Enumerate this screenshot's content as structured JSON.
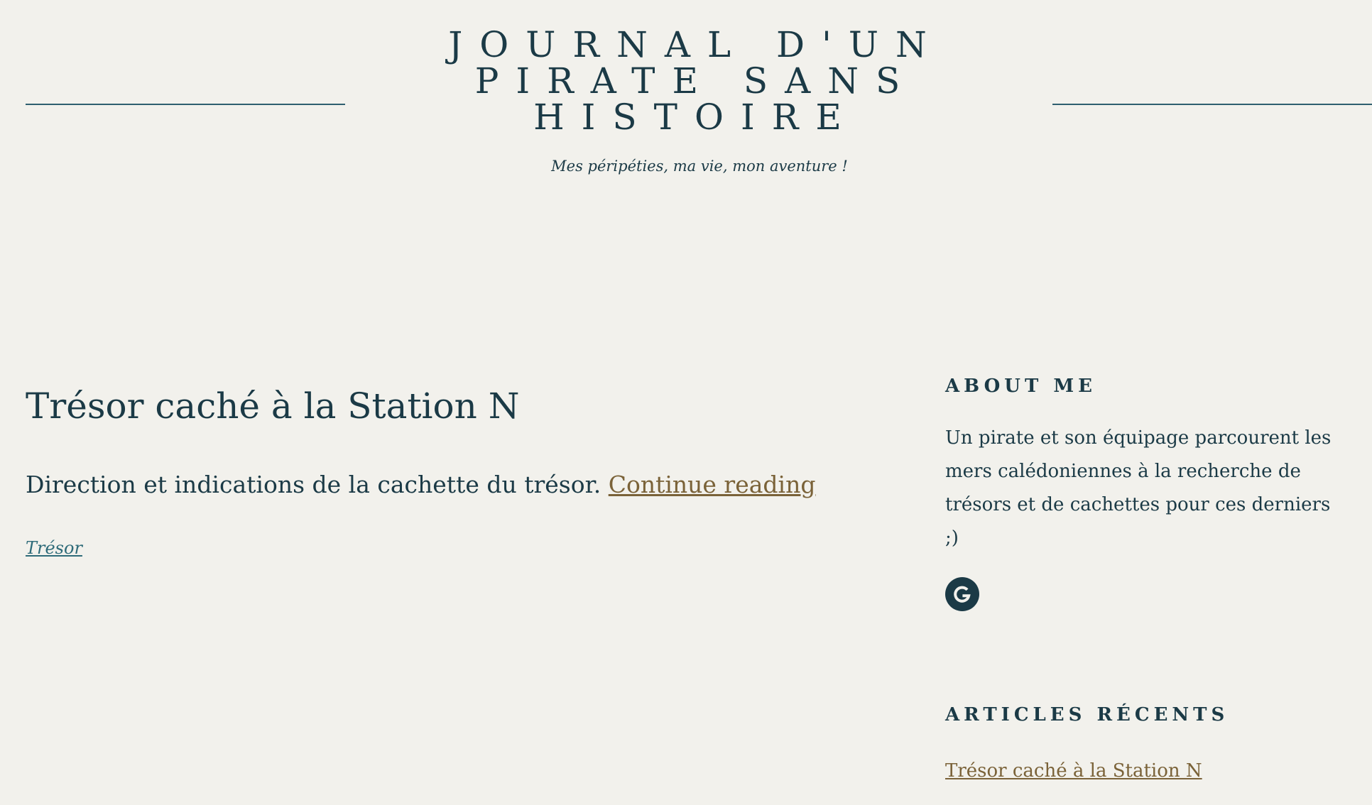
{
  "site": {
    "title_lines": [
      "Journal d'un",
      "pirate sans",
      "histoire"
    ],
    "tagline": "Mes péripéties, ma vie, mon aventure !"
  },
  "post": {
    "title": "Trésor caché à la Station N",
    "excerpt": "Direction et indications de la cachette du trésor.",
    "continue_label": "Continue reading",
    "category": "Trésor"
  },
  "sidebar": {
    "about": {
      "title": "About me",
      "text": "Un pirate et son équipage parcourent les mers calédoniennes à la recherche de trésors et de cachettes pour ces derniers ;)",
      "social_icon": "google-icon"
    },
    "recent": {
      "title": "Articles récents",
      "items": [
        "Trésor caché à la Station N"
      ]
    }
  },
  "colors": {
    "background": "#f2f1ec",
    "text": "#1b3a46",
    "link": "#7a6238",
    "category_link": "#2e6b79",
    "rule": "#2f5f6f"
  }
}
